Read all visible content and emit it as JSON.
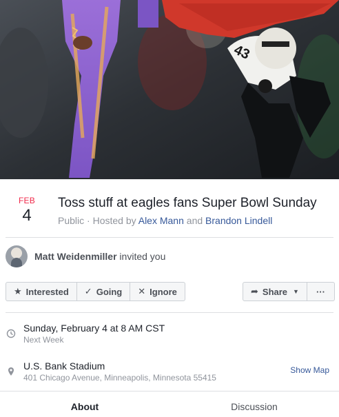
{
  "event": {
    "month": "FEB",
    "day": "4",
    "title": "Toss stuff at eagles fans Super Bowl Sunday",
    "privacy": "Public",
    "hosted_by_prefix": " · Hosted by ",
    "host_1": "Alex Mann",
    "host_joiner": " and ",
    "host_2": "Brandon Lindell"
  },
  "invite": {
    "inviter": "Matt Weidenmiller",
    "suffix": " invited you"
  },
  "actions": {
    "interested": "Interested",
    "going": "Going",
    "ignore": "Ignore",
    "share": "Share",
    "more": "···"
  },
  "details": {
    "datetime": "Sunday, February 4 at 8 AM CST",
    "relative": "Next Week",
    "venue": "U.S. Bank Stadium",
    "address": "401 Chicago Avenue, Minneapolis, Minnesota 55415",
    "show_map": "Show Map"
  },
  "tabs": [
    "About",
    "Discussion"
  ],
  "colors": {
    "month_red": "#f02849",
    "link_blue": "#365899",
    "muted": "#90949c"
  },
  "icons": {
    "interested": "star-icon",
    "going": "check-icon",
    "ignore": "x-icon",
    "share": "share-arrow-icon",
    "time": "clock-icon",
    "location": "map-pin-icon"
  }
}
